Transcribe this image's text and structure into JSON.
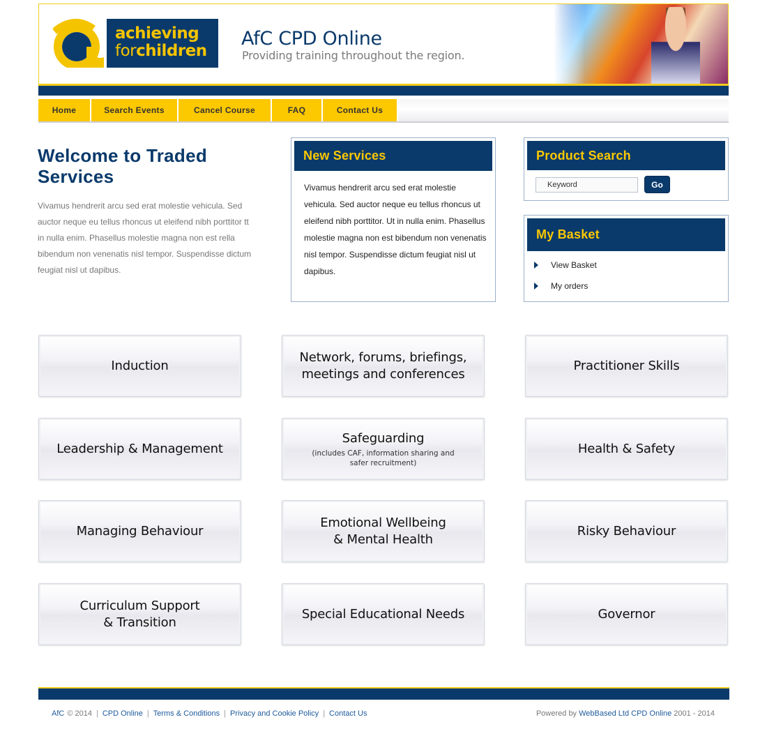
{
  "header": {
    "logo_line1": "achieving",
    "logo_line2_a": "for",
    "logo_line2_b": "children",
    "site_title": "AfC CPD Online",
    "tagline": "Providing training throughout the region."
  },
  "nav": {
    "items": [
      {
        "label": "Home"
      },
      {
        "label": "Search Events"
      },
      {
        "label": "Cancel Course"
      },
      {
        "label": "FAQ"
      },
      {
        "label": "Contact Us"
      }
    ]
  },
  "welcome": {
    "title": "Welcome to Traded Services",
    "body": "Vivamus hendrerit arcu sed erat molestie vehicula. Sed auctor neque eu tellus rhoncus ut eleifend nibh porttitor tt in nulla enim. Phasellus molestie magna non est rella bibendum non venenatis nisl tempor. Suspendisse dictum feugiat nisl ut dapibus."
  },
  "new_services": {
    "title": "New Services",
    "body": "Vivamus hendrerit arcu sed erat molestie vehicula. Sed auctor neque eu tellus rhoncus ut eleifend nibh porttitor. Ut in nulla enim. Phasellus molestie magna non est bibendum non venenatis nisl tempor. Suspendisse dictum feugiat nisl ut dapibus."
  },
  "product_search": {
    "title": "Product Search",
    "keyword_value": "Keyword",
    "go_label": "Go"
  },
  "basket": {
    "title": "My Basket",
    "view_basket": "View Basket",
    "my_orders": "My orders"
  },
  "tiles": [
    {
      "label": "Induction",
      "sub": ""
    },
    {
      "label": "Network, forums,  briefings,\nmeetings and conferences",
      "sub": ""
    },
    {
      "label": "Practitioner Skills",
      "sub": ""
    },
    {
      "label": "Leadership & Management",
      "sub": ""
    },
    {
      "label": "Safeguarding",
      "sub": "(includes CAF, information sharing and\nsafer recruitment)"
    },
    {
      "label": "Health & Safety",
      "sub": ""
    },
    {
      "label": "Managing Behaviour",
      "sub": ""
    },
    {
      "label": "Emotional Wellbeing\n& Mental Health",
      "sub": ""
    },
    {
      "label": "Risky Behaviour",
      "sub": ""
    },
    {
      "label": "Curriculum Support\n& Transition",
      "sub": ""
    },
    {
      "label": "Special Educational Needs",
      "sub": ""
    },
    {
      "label": "Governor",
      "sub": ""
    }
  ],
  "footer": {
    "afc": "AfC",
    "copyright": "© 2014",
    "links": [
      "CPD Online",
      "Terms & Conditions",
      "Privacy and Cookie Policy",
      "Contact Us"
    ],
    "powered_prefix": "Powered by",
    "powered_link": "WebBased Ltd CPD Online",
    "powered_years": "2001 - 2014"
  },
  "colors": {
    "brand_navy": "#0a3a6b",
    "brand_yellow": "#fcc800"
  }
}
